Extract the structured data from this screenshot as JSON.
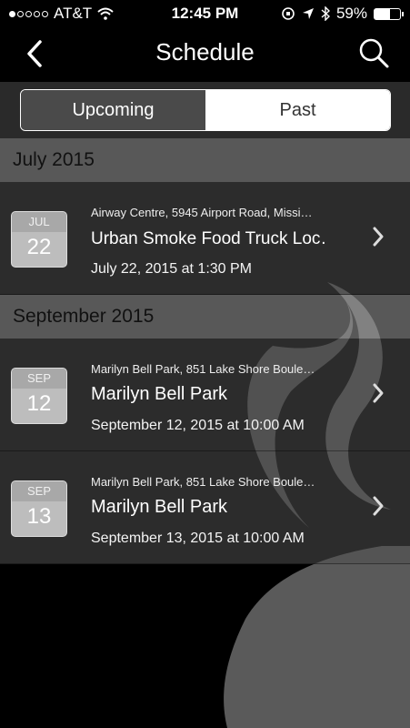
{
  "status_bar": {
    "carrier": "AT&T",
    "time": "12:45 PM",
    "battery_percent": "59%",
    "battery_level": 0.59,
    "icons": [
      "signal-dots-icon",
      "wifi-icon",
      "rotation-lock-icon",
      "location-arrow-icon",
      "bluetooth-icon",
      "battery-icon"
    ]
  },
  "navbar": {
    "title": "Schedule",
    "back_icon": "chevron-left-icon",
    "search_icon": "search-icon"
  },
  "segments": {
    "upcoming_label": "Upcoming",
    "past_label": "Past",
    "selected": "Past"
  },
  "sections": [
    {
      "header": "July 2015",
      "events": [
        {
          "month": "JUL",
          "day": "22",
          "location": "Airway Centre, 5945 Airport Road, Missi…",
          "title": "Urban Smoke Food Truck Loc…",
          "datetime": "July 22, 2015 at 1:30 PM"
        }
      ]
    },
    {
      "header": "September 2015",
      "events": [
        {
          "month": "SEP",
          "day": "12",
          "location": "Marilyn Bell Park, 851 Lake Shore Boule…",
          "title": "Marilyn Bell Park",
          "datetime": "September 12, 2015 at 10:00 AM"
        },
        {
          "month": "SEP",
          "day": "13",
          "location": "Marilyn Bell Park, 851 Lake Shore Boule…",
          "title": "Marilyn Bell Park",
          "datetime": "September 13, 2015 at 10:00 AM"
        }
      ]
    }
  ],
  "colors": {
    "background": "#000000",
    "section_header": "#9a9a9a",
    "row": "#505050",
    "datebox": "#bdbdbd"
  }
}
